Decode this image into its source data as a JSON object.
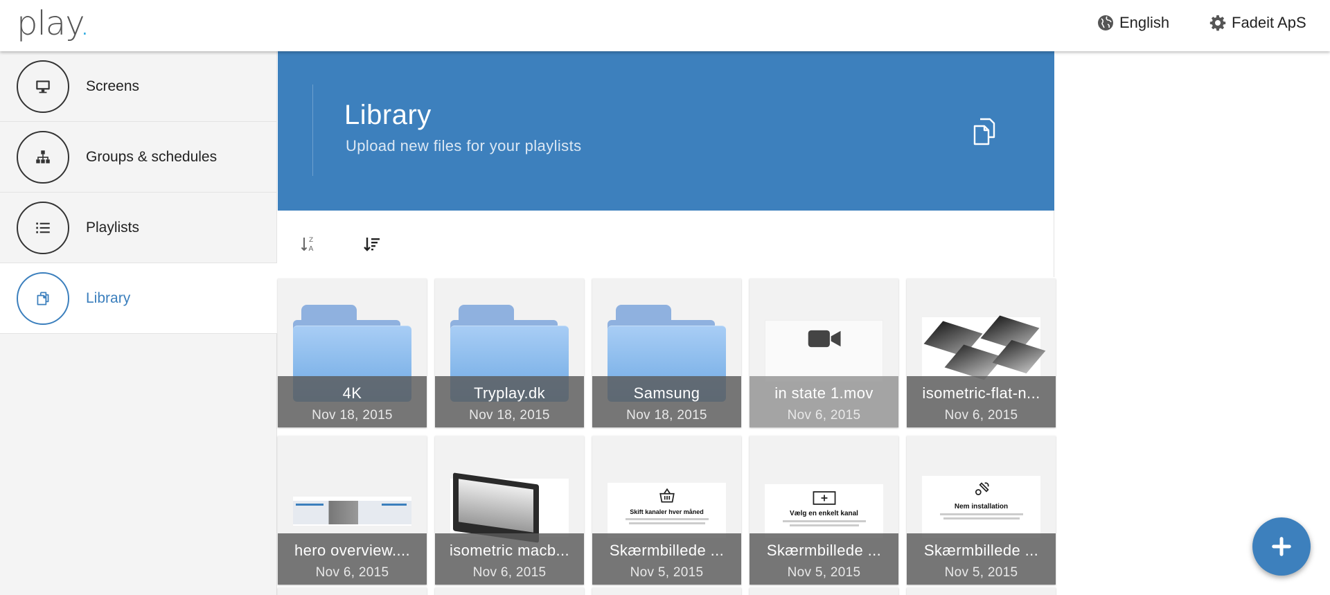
{
  "app": {
    "logo_text": "play",
    "logo_dot": ".",
    "accent_color": "#3d80bd",
    "logo_dot_color": "#29a8e0"
  },
  "topbar": {
    "language": {
      "icon": "globe-icon",
      "label": "English"
    },
    "account": {
      "icon": "gear-icon",
      "label": "Fadeit ApS"
    }
  },
  "sidebar": {
    "items": [
      {
        "label": "Screens",
        "icon": "monitor-icon",
        "active": false
      },
      {
        "label": "Groups & schedules",
        "icon": "sitemap-icon",
        "active": false
      },
      {
        "label": "Playlists",
        "icon": "list-icon",
        "active": false
      },
      {
        "label": "Library",
        "icon": "files-icon",
        "active": true
      }
    ]
  },
  "hero": {
    "title": "Library",
    "subtitle": "Upload new files for your playlists",
    "icon": "files-icon"
  },
  "toolbar": {
    "sort_alpha_icon": "sort-alpha-desc-icon",
    "sort_amount_icon": "sort-amount-desc-icon"
  },
  "library": {
    "items": [
      {
        "name": "4K",
        "date": "Nov 18, 2015",
        "type": "folder"
      },
      {
        "name": "Tryplay.dk",
        "date": "Nov 18, 2015",
        "type": "folder"
      },
      {
        "name": "Samsung",
        "date": "Nov 18, 2015",
        "type": "folder"
      },
      {
        "name": "in state 1.mov",
        "date": "Nov 6, 2015",
        "type": "video"
      },
      {
        "name": "isometric-flat-n...",
        "date": "Nov 6, 2015",
        "type": "image"
      },
      {
        "name": "hero overview....",
        "date": "Nov 6, 2015",
        "type": "image"
      },
      {
        "name": "isometric macb...",
        "date": "Nov 6, 2015",
        "type": "image"
      },
      {
        "name": "Skærmbillede ...",
        "date": "Nov 5, 2015",
        "type": "image",
        "thumb_heading": "Skift kanaler hver måned"
      },
      {
        "name": "Skærmbillede ...",
        "date": "Nov 5, 2015",
        "type": "image",
        "thumb_heading": "Vælg en enkelt kanal"
      },
      {
        "name": "Skærmbillede ...",
        "date": "Nov 5, 2015",
        "type": "image",
        "thumb_heading": "Nem installation"
      }
    ]
  },
  "fab": {
    "icon": "plus-icon"
  }
}
